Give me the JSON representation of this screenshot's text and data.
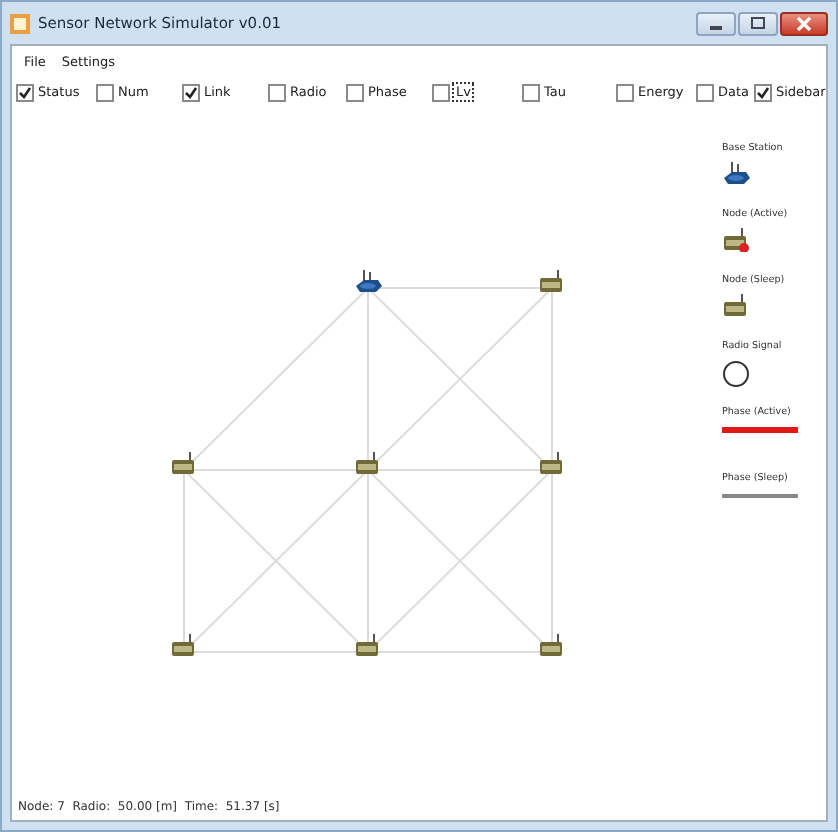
{
  "window": {
    "title": "Sensor Network Simulator v0.01"
  },
  "menu": [
    "File",
    "Settings"
  ],
  "toggles": [
    {
      "label": "Status",
      "checked": true,
      "focused": false
    },
    {
      "label": "Num",
      "checked": false,
      "focused": false
    },
    {
      "label": "Link",
      "checked": true,
      "focused": false
    },
    {
      "label": "Radio",
      "checked": false,
      "focused": false
    },
    {
      "label": "Phase",
      "checked": false,
      "focused": false
    },
    {
      "label": "Lv",
      "checked": false,
      "focused": true
    },
    {
      "label": "Tau",
      "checked": false,
      "focused": false
    },
    {
      "label": "Energy",
      "checked": false,
      "focused": false
    },
    {
      "label": "Data",
      "checked": false,
      "focused": false
    },
    {
      "label": "Sidebar",
      "checked": true,
      "focused": false
    }
  ],
  "network": {
    "rows": [
      [
        {
          "kind": "empty"
        },
        {
          "kind": "base"
        },
        {
          "kind": "sleep"
        }
      ],
      [
        {
          "kind": "sleep"
        },
        {
          "kind": "sleep"
        },
        {
          "kind": "sleep"
        }
      ],
      [
        {
          "kind": "sleep"
        },
        {
          "kind": "sleep"
        },
        {
          "kind": "sleep"
        }
      ]
    ]
  },
  "legend": [
    {
      "kind": "base",
      "label": "Base Station"
    },
    {
      "kind": "active",
      "label": "Node (Active)"
    },
    {
      "kind": "sleep",
      "label": "Node (Sleep)"
    },
    {
      "kind": "radio",
      "label": "Radio Signal"
    },
    {
      "kind": "phase-active",
      "label": "Phase (Active)"
    },
    {
      "kind": "phase-sleep",
      "label": "Phase (Sleep)"
    }
  ],
  "status_bar": "Node: 7  Radio:  50.00 [m]  Time:  51.37 [s]"
}
